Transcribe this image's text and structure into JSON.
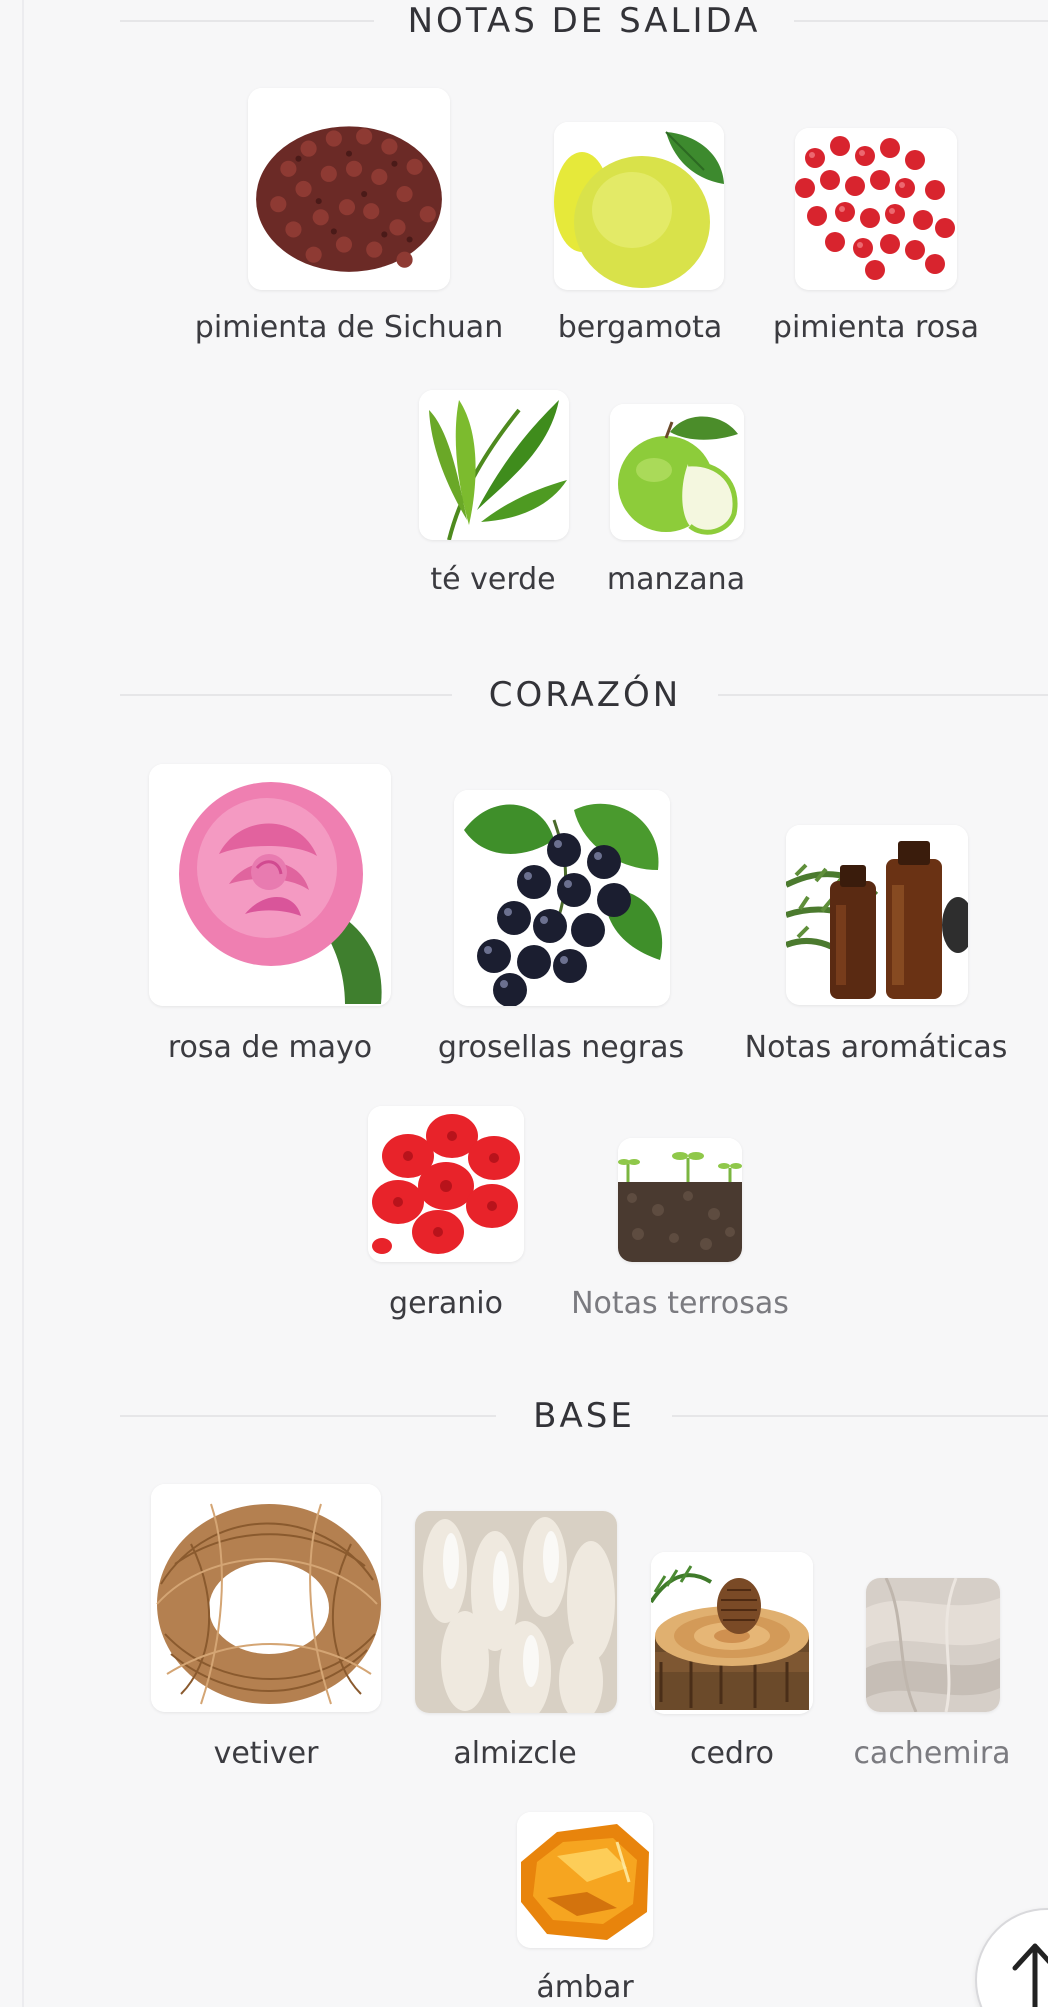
{
  "sections": [
    {
      "title": "NOTAS DE SALIDA",
      "notes": [
        {
          "label": "pimienta de Sichuan",
          "icon": "sichuan-pepper-image"
        },
        {
          "label": "bergamota",
          "icon": "bergamot-image"
        },
        {
          "label": "pimienta rosa",
          "icon": "pink-pepper-image"
        },
        {
          "label": "té verde",
          "icon": "green-tea-image"
        },
        {
          "label": "manzana",
          "icon": "apple-image"
        }
      ]
    },
    {
      "title": "CORAZÓN",
      "notes": [
        {
          "label": "rosa de mayo",
          "icon": "rose-image"
        },
        {
          "label": "grosellas negras",
          "icon": "blackcurrant-image"
        },
        {
          "label": "Notas aromáticas",
          "icon": "aromatic-oils-image"
        },
        {
          "label": "geranio",
          "icon": "geranium-image"
        },
        {
          "label": "Notas terrosas",
          "icon": "soil-image"
        }
      ]
    },
    {
      "title": "BASE",
      "notes": [
        {
          "label": "vetiver",
          "icon": "vetiver-image"
        },
        {
          "label": "almizcle",
          "icon": "musk-image"
        },
        {
          "label": "cedro",
          "icon": "cedar-image"
        },
        {
          "label": "cachemira",
          "icon": "cashmere-image"
        },
        {
          "label": "ámbar",
          "icon": "amber-image"
        }
      ]
    }
  ],
  "scroll_top_icon": "arrow-up-icon",
  "colors": {
    "background": "#f7f7f8",
    "text": "#3b3b40",
    "muted_text": "#7b7b80",
    "rule": "#e6e6e8"
  }
}
